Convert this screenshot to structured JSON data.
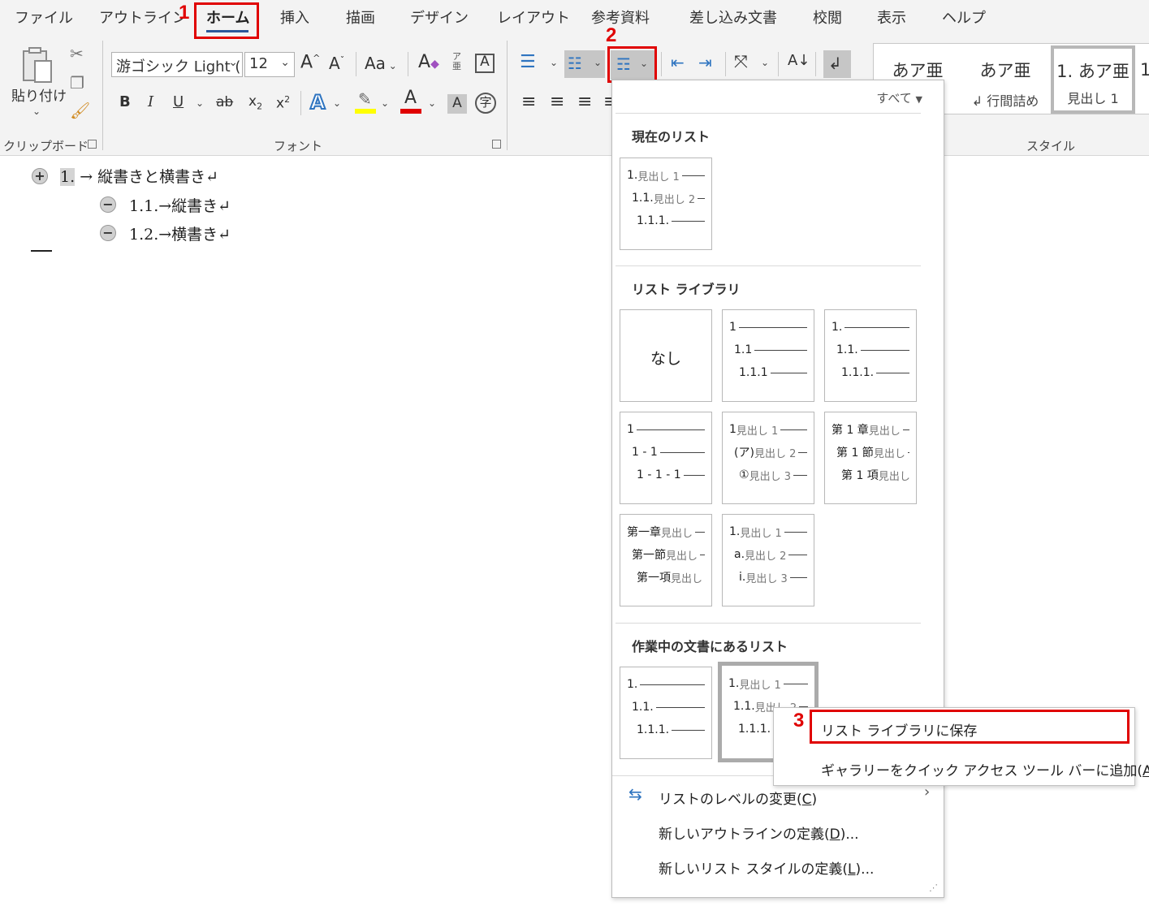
{
  "tabs": [
    "ファイル",
    "アウトライン",
    "ホーム",
    "挿入",
    "描画",
    "デザイン",
    "レイアウト",
    "参考資料",
    "差し込み文書",
    "校閲",
    "表示",
    "ヘルプ"
  ],
  "steps": {
    "one": "1",
    "two": "2",
    "three": "3"
  },
  "clipboard": {
    "paste_label": "貼り付け",
    "group_label": "クリップボード"
  },
  "font": {
    "name": "游ゴシック Light (",
    "size": "12",
    "group_label": "フォント",
    "highlight_color": "#ffff00",
    "font_color": "#e00000"
  },
  "styles": {
    "group_label": "スタイル",
    "tiles": [
      {
        "big": "あア亜",
        "small": ""
      },
      {
        "big": "あア亜",
        "small": "↲ 行間詰め"
      },
      {
        "big": "1. あア亜",
        "small": "見出し 1"
      }
    ]
  },
  "document": {
    "lines": [
      {
        "num": "1.",
        "text": "→ 縦書きと横書き↵"
      },
      {
        "text": "1.1.→縦書き↵"
      },
      {
        "text": "1.2.→横書き↵"
      }
    ]
  },
  "dropdown": {
    "filter": "すべて",
    "current_header": "現在のリスト",
    "library_header": "リスト ライブラリ",
    "document_header": "作業中の文書にあるリスト",
    "none_label": "なし",
    "lists": {
      "current": [
        [
          "1.",
          "見出し 1"
        ],
        [
          "1.1.",
          "見出し 2"
        ],
        [
          "1.1.1.",
          ""
        ]
      ],
      "lib_b": [
        [
          "1",
          ""
        ],
        [
          "1.1",
          ""
        ],
        [
          "1.1.1",
          ""
        ]
      ],
      "lib_c": [
        [
          "1.",
          ""
        ],
        [
          "1.1.",
          ""
        ],
        [
          "1.1.1.",
          ""
        ]
      ],
      "lib_d": [
        [
          "1",
          ""
        ],
        [
          "1 - 1",
          ""
        ],
        [
          "1 - 1 - 1",
          ""
        ]
      ],
      "lib_e": [
        [
          "1",
          "見出し 1"
        ],
        [
          "(ア)",
          "見出し 2"
        ],
        [
          "①",
          "見出し 3"
        ]
      ],
      "lib_f": [
        [
          "第 1 章",
          "見出し"
        ],
        [
          "第 1 節",
          "見出し"
        ],
        [
          "第 1 項",
          "見出し"
        ]
      ],
      "lib_g": [
        [
          "第一章",
          "見出し"
        ],
        [
          "第一節",
          "見出し"
        ],
        [
          "第一項",
          "見出し"
        ]
      ],
      "lib_h": [
        [
          "1.",
          "見出し 1"
        ],
        [
          "a.",
          "見出し 2"
        ],
        [
          "i.",
          "見出し 3"
        ]
      ],
      "doc_a": [
        [
          "1.",
          ""
        ],
        [
          "1.1.",
          ""
        ],
        [
          "1.1.1.",
          ""
        ]
      ],
      "doc_b": [
        [
          "1.",
          "見出し 1"
        ],
        [
          "1.1.",
          "見出し 2"
        ],
        [
          "1.1.1.",
          ""
        ]
      ]
    },
    "commands": {
      "change_level": {
        "pre": "リストのレベルの変更(",
        "key": "C",
        "post": ")"
      },
      "define_outline": {
        "pre": "新しいアウトラインの定義(",
        "key": "D",
        "post": ")..."
      },
      "define_style": {
        "pre": "新しいリスト スタイルの定義(",
        "key": "L",
        "post": ")..."
      }
    }
  },
  "context_menu": {
    "save": "リスト ライブラリに保存",
    "add_qat": {
      "pre": "ギャラリーをクイック アクセス ツール バーに追加(",
      "key": "A",
      "post": ")"
    }
  }
}
